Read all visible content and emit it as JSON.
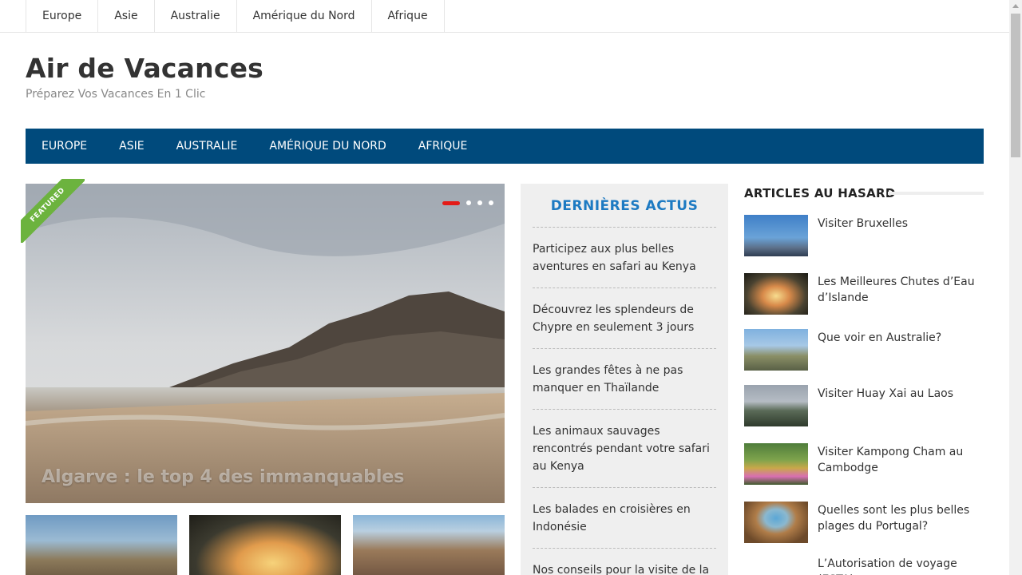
{
  "top_nav": [
    "Europe",
    "Asie",
    "Australie",
    "Amérique du Nord",
    "Afrique"
  ],
  "site": {
    "title": "Air de Vacances",
    "tagline": "Préparez Vos Vacances En 1 Clic"
  },
  "main_nav": [
    "EUROPE",
    "ASIE",
    "AUSTRALIE",
    "AMÉRIQUE DU NORD",
    "AFRIQUE"
  ],
  "slider": {
    "badge": "FEATURED",
    "title": "Algarve : le top 4 des immanquables",
    "slide_count": 4,
    "active_slide": 1
  },
  "latest_news": {
    "title": "DERNIÈRES ACTUS",
    "items": [
      "Participez aux plus belles aventures en safari au Kenya",
      "Découvrez les splendeurs de Chypre en seulement 3 jours",
      "Les grandes fêtes à ne pas manquer en Thaïlande",
      "Les animaux sauvages rencontrés pendant votre safari au Kenya",
      "Les balades en croisières en Indonésie",
      "Nos conseils pour la visite de la"
    ]
  },
  "random_articles": {
    "title": "ARTICLES AU HASARD",
    "items": [
      "Visiter Bruxelles",
      "Les Meilleures Chutes d’Eau d’Islande",
      "Que voir en Australie?",
      "Visiter Huay Xai au Laos",
      "Visiter Kampong Cham au Cambodge",
      "Quelles sont les plus belles plages du Portugal?",
      "L’Autorisation de voyage (ESTA)"
    ]
  }
}
